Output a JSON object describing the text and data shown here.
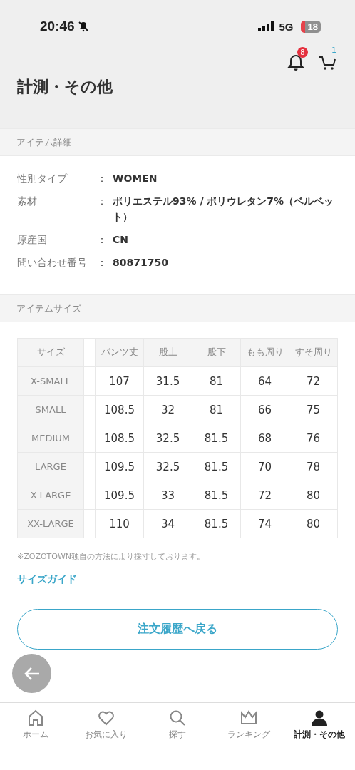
{
  "status_bar": {
    "time": "20:46",
    "network": "5G",
    "battery": "18"
  },
  "header": {
    "title": "計測・その他",
    "notifications_badge": "8",
    "cart_badge": "1"
  },
  "item_details": {
    "heading": "アイテム詳細",
    "rows": [
      {
        "label": "性別タイプ",
        "separator": "：",
        "value": "WOMEN"
      },
      {
        "label": "素材",
        "separator": "：",
        "value": "ポリエステル93% / ポリウレタン7%（ベルベット）"
      },
      {
        "label": "原産国",
        "separator": "：",
        "value": "CN"
      },
      {
        "label": "問い合わせ番号",
        "separator": "：",
        "value": "80871750"
      }
    ]
  },
  "item_size": {
    "heading": "アイテムサイズ",
    "table": {
      "columns": [
        "サイズ",
        "パンツ丈",
        "股上",
        "股下",
        "もも周り",
        "すそ周り"
      ],
      "rows": [
        [
          "X-SMALL",
          "107",
          "31.5",
          "81",
          "64",
          "72"
        ],
        [
          "SMALL",
          "108.5",
          "32",
          "81",
          "66",
          "75"
        ],
        [
          "MEDIUM",
          "108.5",
          "32.5",
          "81.5",
          "68",
          "76"
        ],
        [
          "LARGE",
          "109.5",
          "32.5",
          "81.5",
          "70",
          "78"
        ],
        [
          "X-LARGE",
          "109.5",
          "33",
          "81.5",
          "72",
          "80"
        ],
        [
          "XX-LARGE",
          "110",
          "34",
          "81.5",
          "74",
          "80"
        ]
      ]
    },
    "note": "※ZOZOTOWN独自の方法により採寸しております。",
    "guide_link": "サイズガイド"
  },
  "back_button": "注文履歴へ戻る",
  "tab_bar": [
    {
      "label": "ホーム",
      "kind": "home",
      "selected": false
    },
    {
      "label": "お気に入り",
      "kind": "favorites",
      "selected": false
    },
    {
      "label": "探す",
      "kind": "search",
      "selected": false
    },
    {
      "label": "ランキング",
      "kind": "ranking",
      "selected": false
    },
    {
      "label": "計測・その他",
      "kind": "account",
      "selected": true
    }
  ]
}
